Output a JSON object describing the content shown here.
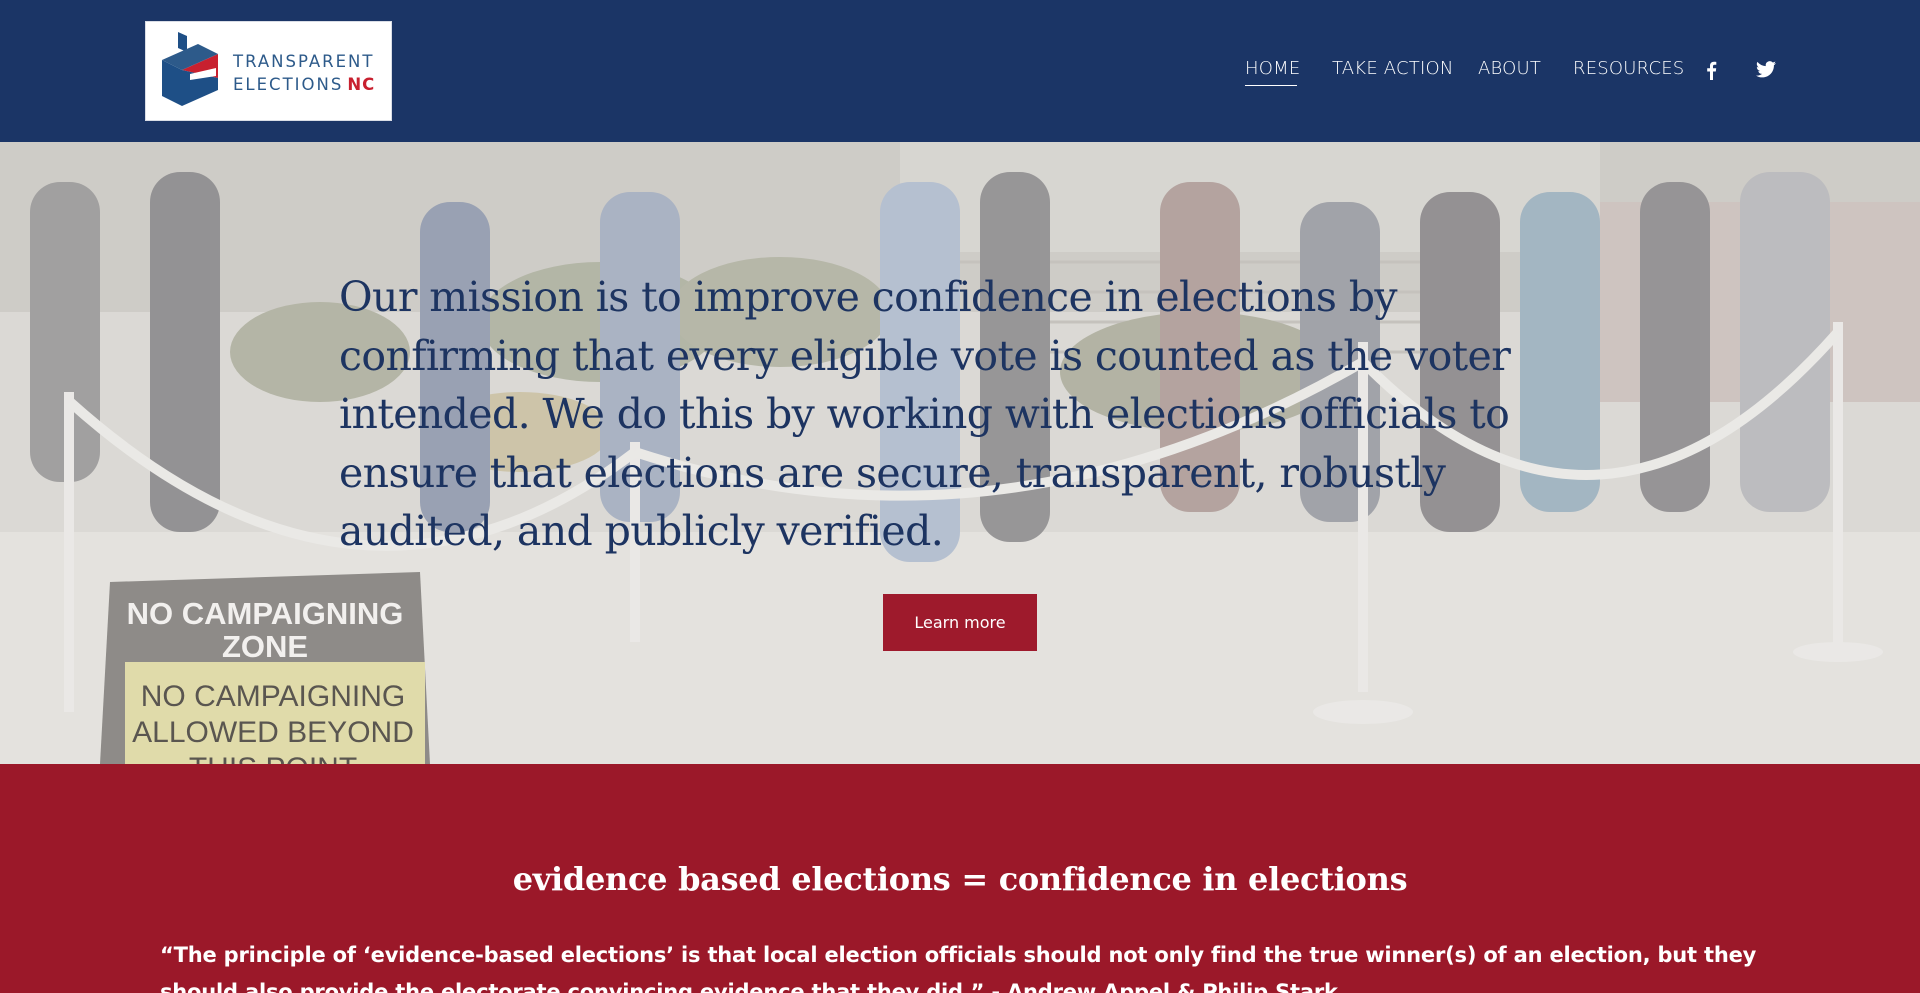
{
  "brand": {
    "line1": "TRANSPARENT",
    "line2": "ELECTIONS",
    "accent": "NC",
    "colors": {
      "blue": "#2d5a8a",
      "red": "#c8202f"
    }
  },
  "nav": {
    "items": [
      {
        "label": "HOME",
        "active": true
      },
      {
        "label": "TAKE ACTION"
      },
      {
        "label": "ABOUT"
      },
      {
        "label": "RESOURCES"
      }
    ],
    "social": [
      "facebook-icon",
      "twitter-icon"
    ]
  },
  "hero": {
    "mission": "Our mission is to improve confidence in elections by confirming that every eligible vote is counted as the voter intended. We do this by working with elections officials to ensure that elections are secure, transparent, robustly audited, and publicly verified.",
    "button": "Learn more",
    "sign_line1": "NO CAMPAIGNING",
    "sign_line2": "ZONE",
    "sign_line3": "NO CAMPAIGNING",
    "sign_line4": "ALLOWED BEYOND",
    "sign_line5": "THIS POINT"
  },
  "evidence": {
    "title": "evidence based elections = confidence in elections",
    "quote": "“The principle of ‘evidence-based elections’ is that local election officials should not only find the true winner(s) of an election, but they should also provide the electorate convincing evidence that they did.” - Andrew Appel & Philip Stark"
  },
  "colors": {
    "header_bg": "#1b3566",
    "button_bg": "#9e1a2c",
    "section_bg": "#9b1829",
    "mission_text": "#1d3461"
  }
}
